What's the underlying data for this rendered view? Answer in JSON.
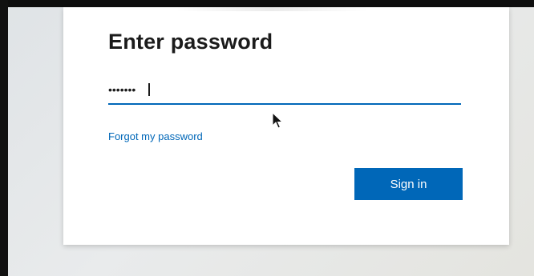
{
  "signin_dialog": {
    "title": "Enter password",
    "password_field": {
      "value": "•••••••"
    },
    "forgot_link_label": "Forgot my password",
    "signin_button_label": "Sign in"
  },
  "colors": {
    "accent": "#0067b8",
    "title_text": "#1b1b1b",
    "card_background": "#ffffff"
  },
  "icons": {
    "pointer": "mouse-pointer-icon"
  }
}
